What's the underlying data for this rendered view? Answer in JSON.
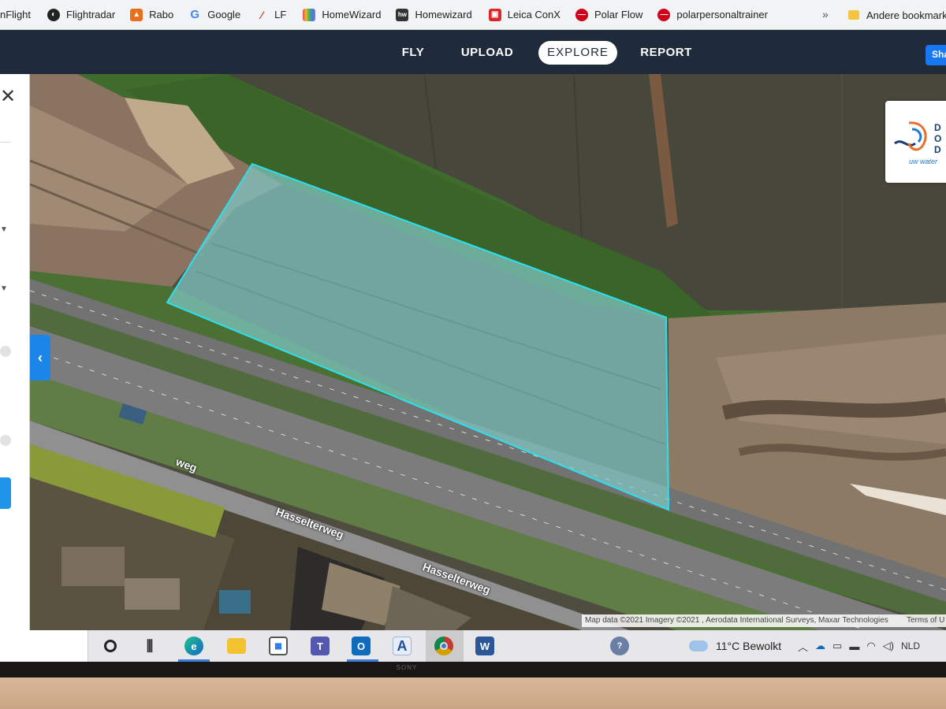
{
  "bookmarks": [
    {
      "label": "nFlight",
      "icon": "blank-icon",
      "color": "#f1f3f4"
    },
    {
      "label": "Flightradar",
      "icon": "radar-icon",
      "color": "#222222"
    },
    {
      "label": "Rabo",
      "icon": "rabo-icon",
      "color": "#e8701a"
    },
    {
      "label": "Google",
      "icon": "google-icon",
      "color": "#4285f4"
    },
    {
      "label": "LF",
      "icon": "lf-icon",
      "color": "#d03a2a"
    },
    {
      "label": "HomeWizard",
      "icon": "homewizard-icon",
      "color": "#8a6fd1"
    },
    {
      "label": "Homewizard",
      "icon": "homewizard-dark-icon",
      "color": "#333333"
    },
    {
      "label": "Leica ConX",
      "icon": "leica-icon",
      "color": "#d8262b"
    },
    {
      "label": "Polar Flow",
      "icon": "polar-icon",
      "color": "#d0021b"
    },
    {
      "label": "polarpersonaltrainer",
      "icon": "polar-icon",
      "color": "#d0021b"
    }
  ],
  "bookmarks_more": "»",
  "bookmarks_other": "Andere bookmarks",
  "nav": {
    "fly": "FLY",
    "upload": "UPLOAD",
    "explore": "EXPLORE",
    "report": "REPORT",
    "share": "Sha"
  },
  "sidepanel": {
    "close_glyph": "✕",
    "collapse_glyph": "‹"
  },
  "map": {
    "road_labels": [
      "Hasselterweg",
      "Hasselterweg",
      "weg"
    ],
    "attribution": "Map data ©2021 Imagery ©2021 , Aerodata International Surveys, Maxar Technologies",
    "terms": "Terms of U",
    "polygon_color": "#29e0f0",
    "logo_letters": [
      "D",
      "O",
      "D"
    ],
    "logo_tag": "uw water"
  },
  "taskbar": {
    "apps": [
      "cortana-icon",
      "task-view-icon",
      "edge-icon",
      "file-explorer-icon",
      "store-icon",
      "teams-icon",
      "outlook-icon",
      "font-app-icon",
      "chrome-icon",
      "word-icon"
    ],
    "weather_temp": "11°C Bewolkt",
    "language": "NLD"
  },
  "bezel_brand": "SONY"
}
